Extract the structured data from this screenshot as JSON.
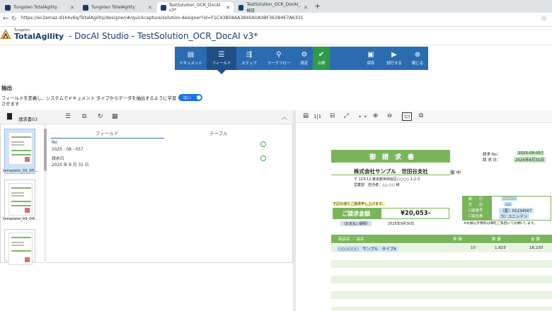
{
  "browser": {
    "tabs": [
      {
        "label": "Tungsten TotalAgility",
        "active": false
      },
      {
        "label": "Tungsten TotalAgility",
        "active": false
      },
      {
        "label": "TestSolution_OCR_DocAI v3*",
        "active": true
      },
      {
        "label": "TestSolution_OCR_DocAI_検証",
        "active": false
      }
    ],
    "url": "https://ec2amaz-d1k4v6q/TotalAgility/designer/#/quickcapture/solution-designer?id=F1C43B58AA3840A0A0BF363B4E7A6331"
  },
  "app": {
    "brand_small": "Tungsten",
    "brand": "TotalAgility",
    "title": "- DocAI Studio - TestSolution_OCR_DocAI v3*"
  },
  "toolbar": {
    "items": [
      {
        "label": "ドキュメント",
        "icon": "document-icon"
      },
      {
        "label": "フィールド",
        "icon": "fields-icon",
        "active": true
      },
      {
        "label": "ステップ",
        "icon": "steps-icon"
      },
      {
        "label": "ワークフロー",
        "icon": "workflow-icon"
      },
      {
        "label": "設定",
        "icon": "gear-icon"
      },
      {
        "label": "公開",
        "icon": "publish-check-icon"
      },
      {
        "label": "保存",
        "icon": "save-icon"
      },
      {
        "label": "試行する",
        "icon": "play-icon"
      },
      {
        "label": "閉じる",
        "icon": "close-icon"
      }
    ]
  },
  "extract": {
    "heading": "抽出",
    "desc1": "フィールドを定義し、システムでドキュメント タイプからデータを抽出するように学習",
    "desc2": "させます",
    "toggle_label": "はい"
  },
  "left_panel": {
    "doc_name": "請求書03",
    "thumbnails": [
      {
        "caption": "template_03_05..."
      },
      {
        "caption": "template_03_04..."
      },
      {
        "caption": ""
      }
    ],
    "tabs": [
      "フィールド",
      "テーブル"
    ],
    "fields": [
      {
        "label": "No",
        "value": "2025 - 08 - 057"
      },
      {
        "label": "請求日",
        "value": "2025 年 8 月 31 日"
      }
    ]
  },
  "viewer": {
    "page": "1|1",
    "zoom_labels": [
      "+ +"
    ]
  },
  "invoice": {
    "title": "御　請　求　書",
    "no_label": "請求 No：",
    "no_value": "2025-08-057",
    "date_label": "請 求 日：",
    "date_value": "2025年8月31日",
    "customer": "株式会社サンプル　世田谷支社",
    "honorific": "御 中",
    "address": "〒 123-12 東京都世田谷区○○○○ 1-2-3",
    "contact": "営業部　担当者：△△ ○○ 様",
    "request_note": "下記の通りご請求申し上げます。",
    "amount_label": "ご請求金額",
    "amount_value": "¥20,053-",
    "due_label": "（お支払い期限）",
    "due_value": "2025年9月30日",
    "bank_rows": [
      {
        "k": "銀　　行",
        "v": "○○○○"
      },
      {
        "k": "支　　店",
        "v": "△△"
      },
      {
        "k": "口座番号",
        "v": "（普）01234567"
      },
      {
        "k": "口座名義",
        "v": "カ）ユニッテン"
      }
    ],
    "fee_note": "※お振込手数料は御社ご負担にてお願いします。",
    "cols": [
      "商品名 ／ 品名",
      "単 価",
      "数 量",
      "金 額"
    ],
    "row": {
      "name": "○○○○○○　サンプル　タイプA",
      "price": "10",
      "qty": "1,823",
      "amount": "18,230"
    }
  }
}
